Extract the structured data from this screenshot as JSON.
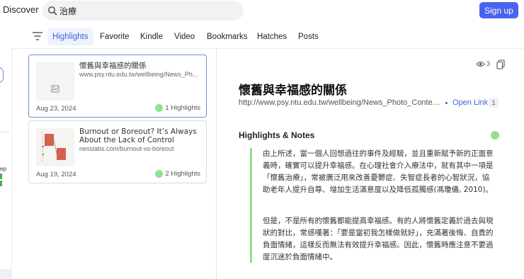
{
  "header": {
    "brand": "Discover",
    "search_value": "治療",
    "signup_label": "Sign up"
  },
  "tabs": [
    "Highlights",
    "Favorite",
    "Kindle",
    "Video",
    "Bookmarks",
    "Hatches",
    "Posts"
  ],
  "active_tab": "Highlights",
  "left_rail": {
    "fragment_text": "ep"
  },
  "cards": [
    {
      "title": "懷舊與幸福感的關係",
      "url": "www.psy.ntu.edu.tw/wellbeing/News_Ph...",
      "date": "Aug 23, 2024",
      "highlights": "1 Highlights",
      "thumb_icon": "image-placeholder-icon"
    },
    {
      "title": "Burnout or Boreout? It’s Always About the Lack of Control",
      "url": "nesslabs.com/burnout-vs-boreout",
      "date": "Aug 19, 2024",
      "highlights": "2 Highlights",
      "thumb_icon": "article-thumbnail"
    }
  ],
  "detail": {
    "views": "3",
    "title": "懷舊與幸福感的關係",
    "url": "http://www.psy.ntu.edu.tw/wellbeing/News_Photo_Content...",
    "open_link_label": "Open Link",
    "open_link_count": "1",
    "section_title": "Highlights & Notes",
    "highlight_paragraph_1": "由上所述，當一個人回想過往的事件及經驗，並且重新賦予新的正面意義時，確實可以提升幸福感。在心理社會介入療法中，就有其中一項是「懷舊治療」，常被廣泛用來改善憂鬱症、失智症長者的心智狀況，協助老年人提升自尊、增加生活滿意度以及降低孤獨感(馮瓊儀, 2010)。",
    "highlight_paragraph_2": "但是，不是所有的懷舊都能提高幸福感。有的人將懷舊定義於過去與現狀的對比，常感嘆著：「要是當初我怎樣做就好」，充滿著後悔、自責的負面情緒，這樣反而無法有效提升幸福感。因此，懷舊時應注意不要過度沉迷於負面情緒中。"
  },
  "colors": {
    "accent": "#4a63ee",
    "link": "#3b63d9",
    "highlight_green": "#90e28f",
    "quote_bar": "#8fe08d",
    "selected_border": "#6b8fd6"
  }
}
